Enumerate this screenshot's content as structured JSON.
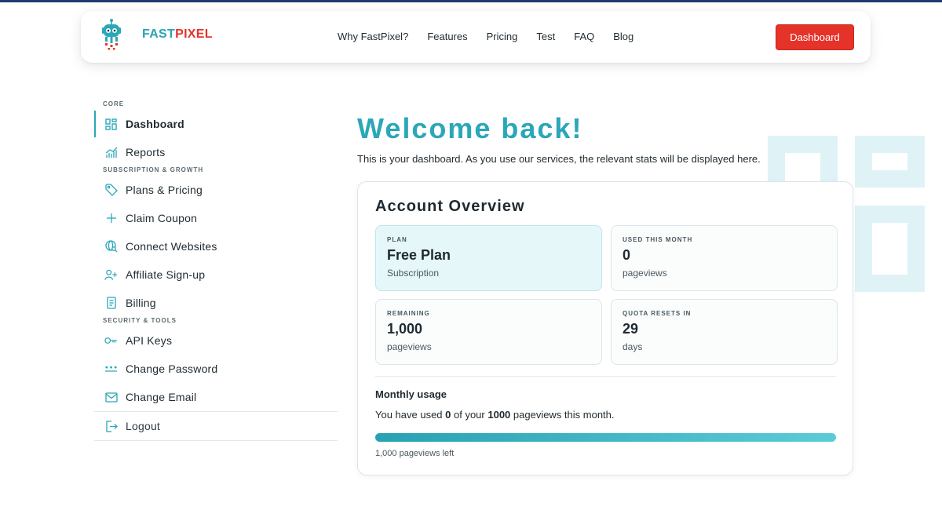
{
  "header": {
    "logo": {
      "text_fast": "FAST",
      "text_pixel": "PIXEL"
    },
    "nav": [
      "Why FastPixel?",
      "Features",
      "Pricing",
      "Test",
      "FAQ",
      "Blog"
    ],
    "dashboard_button": "Dashboard"
  },
  "sidebar": {
    "sections": [
      {
        "title": "CORE",
        "items": [
          {
            "label": "Dashboard",
            "icon": "grid-icon",
            "active": true
          },
          {
            "label": "Reports",
            "icon": "chart-icon"
          }
        ]
      },
      {
        "title": "SUBSCRIPTION & GROWTH",
        "items": [
          {
            "label": "Plans & Pricing",
            "icon": "tag-icon"
          },
          {
            "label": "Claim Coupon",
            "icon": "plus-icon"
          },
          {
            "label": "Connect Websites",
            "icon": "globe-search-icon"
          },
          {
            "label": "Affiliate Sign-up",
            "icon": "user-plus-icon"
          },
          {
            "label": "Billing",
            "icon": "receipt-icon"
          }
        ]
      },
      {
        "title": "SECURITY & TOOLS",
        "items": [
          {
            "label": "API Keys",
            "icon": "key-icon"
          },
          {
            "label": "Change Password",
            "icon": "password-dots-icon"
          },
          {
            "label": "Change Email",
            "icon": "mail-icon"
          }
        ]
      }
    ],
    "logout": {
      "label": "Logout",
      "icon": "logout-icon"
    }
  },
  "main": {
    "title": "Welcome back!",
    "intro": "This is your dashboard. As you use our services, the relevant stats will be displayed here.",
    "overview": {
      "title": "Account Overview",
      "stats": [
        {
          "key": "PLAN",
          "value": "Free Plan",
          "sub": "Subscription",
          "highlight": true
        },
        {
          "key": "USED THIS MONTH",
          "value": "0",
          "sub": "pageviews"
        },
        {
          "key": "REMAINING",
          "value": "1,000",
          "sub": "pageviews"
        },
        {
          "key": "QUOTA RESETS IN",
          "value": "29",
          "sub": "days"
        }
      ],
      "usage": {
        "title": "Monthly usage",
        "text_prefix": "You have used ",
        "used": "0",
        "text_mid": " of your ",
        "total": "1000",
        "text_suffix": " pageviews this month.",
        "remaining_fraction": 1.0,
        "left_text": "1,000 pageviews left"
      }
    }
  },
  "colors": {
    "accent": "#2aa7b8",
    "brand_red": "#e5332a",
    "deco": "#dff3f7"
  }
}
